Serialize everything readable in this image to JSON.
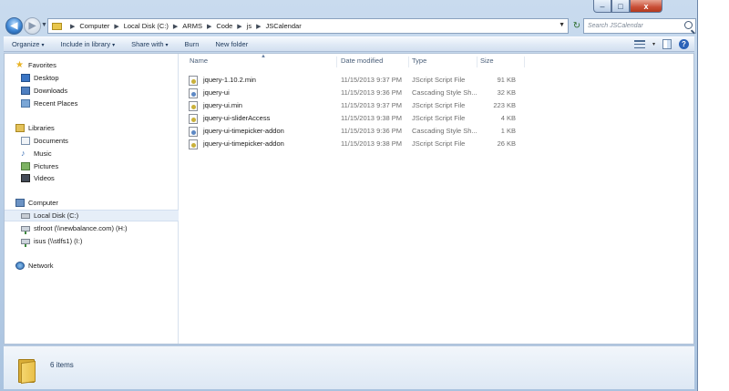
{
  "window": {
    "controls": {
      "minimize": "–",
      "maximize": "□",
      "close": "x"
    }
  },
  "navigation": {
    "back_glyph": "◀",
    "forward_glyph": "▶",
    "dropdown_glyph": "▼",
    "breadcrumbs": [
      "Computer",
      "Local Disk (C:)",
      "ARMS",
      "Code",
      "js",
      "JSCalendar"
    ],
    "separator_glyph": "▶",
    "refresh_glyph": "↻",
    "search_placeholder": "Search JSCalendar"
  },
  "command_bar": {
    "organize": "Organize",
    "include_in_library": "Include in library",
    "share_with": "Share with",
    "burn": "Burn",
    "new_folder": "New folder",
    "dropdown_glyph": "▾",
    "help_glyph": "?"
  },
  "nav_pane": {
    "favorites": {
      "label": "Favorites",
      "items": [
        "Desktop",
        "Downloads",
        "Recent Places"
      ]
    },
    "libraries": {
      "label": "Libraries",
      "items": [
        "Documents",
        "Music",
        "Pictures",
        "Videos"
      ]
    },
    "computer": {
      "label": "Computer",
      "items": [
        "Local Disk (C:)",
        "stlroot (\\\\newbalance.com) (H:)",
        "isus (\\\\stlfs1) (I:)"
      ]
    },
    "network": {
      "label": "Network"
    },
    "icons": {
      "star": "★",
      "music": "♪"
    }
  },
  "file_list": {
    "columns": {
      "name": "Name",
      "date": "Date modified",
      "type": "Type",
      "size": "Size"
    },
    "sort_glyph": "▲",
    "files": [
      {
        "name": "jquery-1.10.2.min",
        "date": "11/15/2013 9:37 PM",
        "type": "JScript Script File",
        "size": "91 KB",
        "icon": "js"
      },
      {
        "name": "jquery-ui",
        "date": "11/15/2013 9:36 PM",
        "type": "Cascading Style Sh...",
        "size": "32 KB",
        "icon": "css"
      },
      {
        "name": "jquery-ui.min",
        "date": "11/15/2013 9:37 PM",
        "type": "JScript Script File",
        "size": "223 KB",
        "icon": "js"
      },
      {
        "name": "jquery-ui-sliderAccess",
        "date": "11/15/2013 9:38 PM",
        "type": "JScript Script File",
        "size": "4 KB",
        "icon": "js"
      },
      {
        "name": "jquery-ui-timepicker-addon",
        "date": "11/15/2013 9:36 PM",
        "type": "Cascading Style Sh...",
        "size": "1 KB",
        "icon": "css"
      },
      {
        "name": "jquery-ui-timepicker-addon",
        "date": "11/15/2013 9:38 PM",
        "type": "JScript Script File",
        "size": "26 KB",
        "icon": "js"
      }
    ]
  },
  "details_pane": {
    "item_count": "6 items"
  }
}
